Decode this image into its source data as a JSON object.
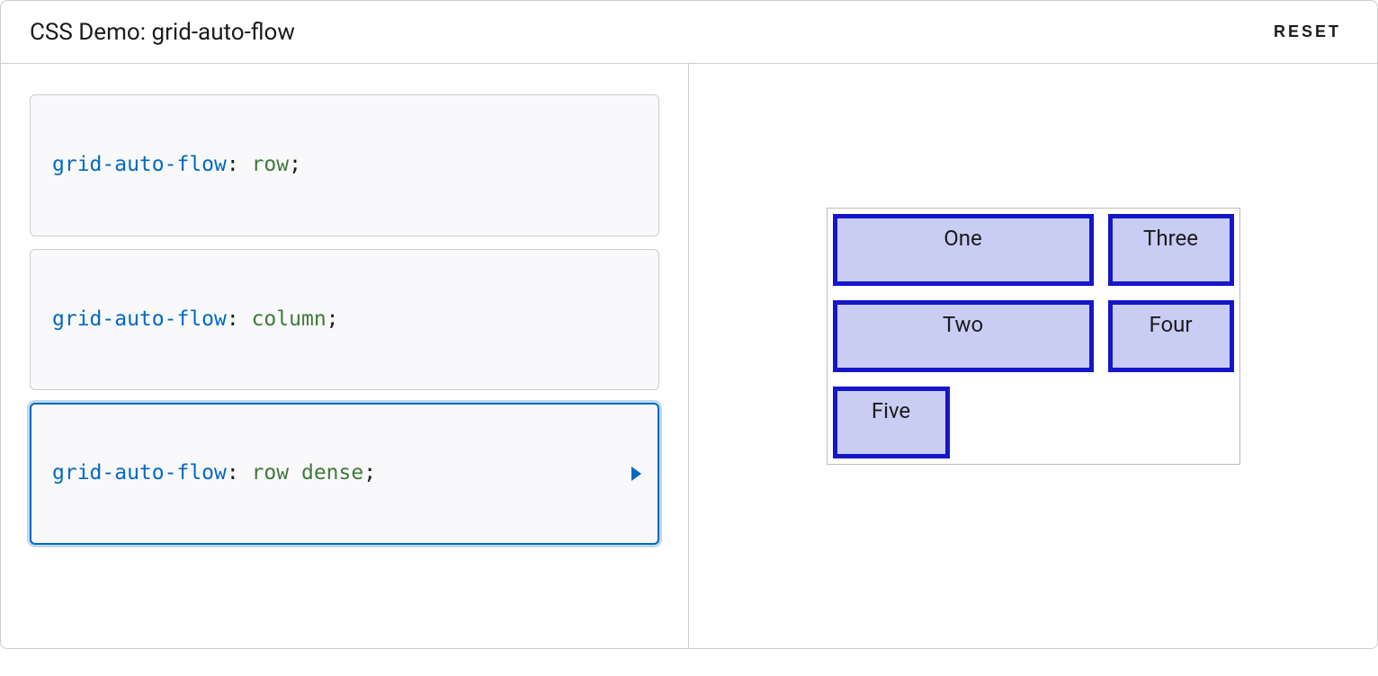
{
  "header": {
    "title": "CSS Demo: grid-auto-flow",
    "reset": "RESET"
  },
  "choices": [
    {
      "prop": "grid-auto-flow",
      "value": "row",
      "selected": false
    },
    {
      "prop": "grid-auto-flow",
      "value": "column",
      "selected": false
    },
    {
      "prop": "grid-auto-flow",
      "value": "row dense",
      "selected": true
    }
  ],
  "grid": {
    "items": [
      "One",
      "Three",
      "Two",
      "Four",
      "Five"
    ]
  }
}
